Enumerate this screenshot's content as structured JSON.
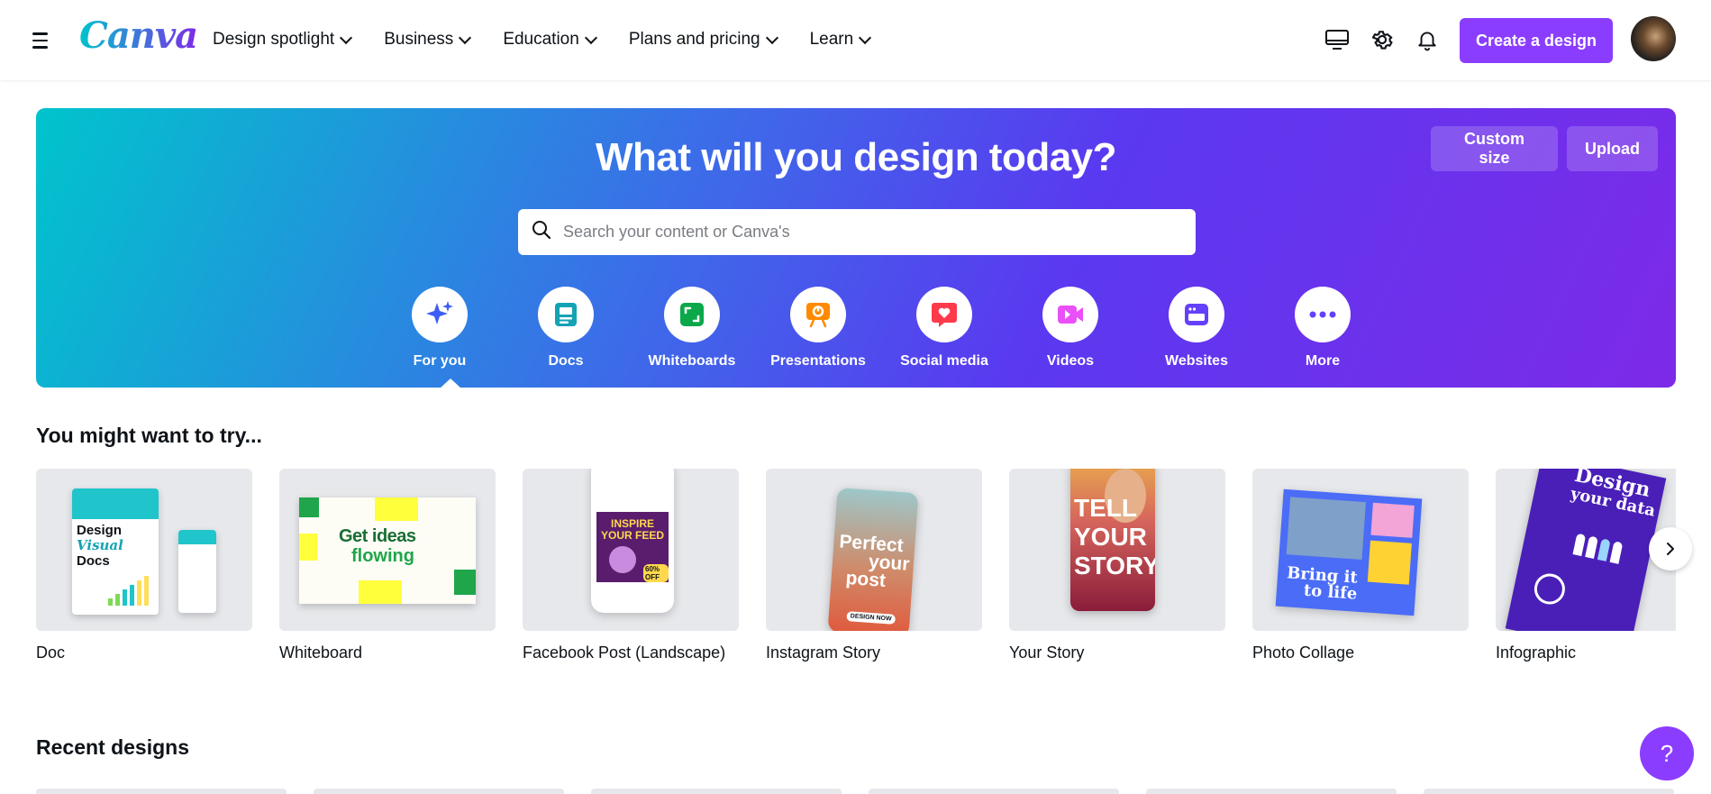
{
  "header": {
    "logo": "Canva",
    "nav": [
      "Design spotlight",
      "Business",
      "Education",
      "Plans and pricing",
      "Learn"
    ],
    "create_button": "Create a design"
  },
  "hero": {
    "title": "What will you design today?",
    "custom_size": "Custom size",
    "upload": "Upload",
    "search_placeholder": "Search your content or Canva's",
    "categories": [
      {
        "label": "For you",
        "icon": "sparkle-icon",
        "color": "#3d5df4"
      },
      {
        "label": "Docs",
        "icon": "doc-icon",
        "color": "#13a3b5"
      },
      {
        "label": "Whiteboards",
        "icon": "whiteboard-icon",
        "color": "#0ba84a"
      },
      {
        "label": "Presentations",
        "icon": "presentation-icon",
        "color": "#ff8a00"
      },
      {
        "label": "Social media",
        "icon": "heart-icon",
        "color": "#ff3b4b"
      },
      {
        "label": "Videos",
        "icon": "video-icon",
        "color": "#e950f7"
      },
      {
        "label": "Websites",
        "icon": "website-icon",
        "color": "#6440fa"
      },
      {
        "label": "More",
        "icon": "more-icon",
        "color": "#6440fa"
      }
    ],
    "gradient": [
      "#00c4cc",
      "#7d2ae8"
    ]
  },
  "suggestions": {
    "title": "You might want to try...",
    "items": [
      {
        "label": "Doc",
        "art": {
          "l1": "Design",
          "l2": "Visual",
          "l3": "Docs"
        }
      },
      {
        "label": "Whiteboard",
        "art": {
          "l1": "Get ideas",
          "l2": "flowing"
        }
      },
      {
        "label": "Facebook Post (Landscape)",
        "art": {
          "l1": "INSPIRE",
          "l2": "YOUR FEED",
          "l3": "60% OFF"
        }
      },
      {
        "label": "Instagram Story",
        "art": {
          "l1": "Perfect",
          "l2": "your",
          "l3": "post",
          "l4": "DESIGN NOW"
        }
      },
      {
        "label": "Your Story",
        "art": {
          "l1": "TELL",
          "l2": "YOUR",
          "l3": "STORY"
        }
      },
      {
        "label": "Photo Collage",
        "art": {
          "l1": "Bring it",
          "l2": "to life"
        }
      },
      {
        "label": "Infographic",
        "art": {
          "l1": "Design",
          "l2": "your data"
        }
      }
    ]
  },
  "recent": {
    "title": "Recent designs"
  },
  "help": {
    "label": "?"
  },
  "colors": {
    "brand_purple": "#8b3dff",
    "text": "#0e1318"
  }
}
